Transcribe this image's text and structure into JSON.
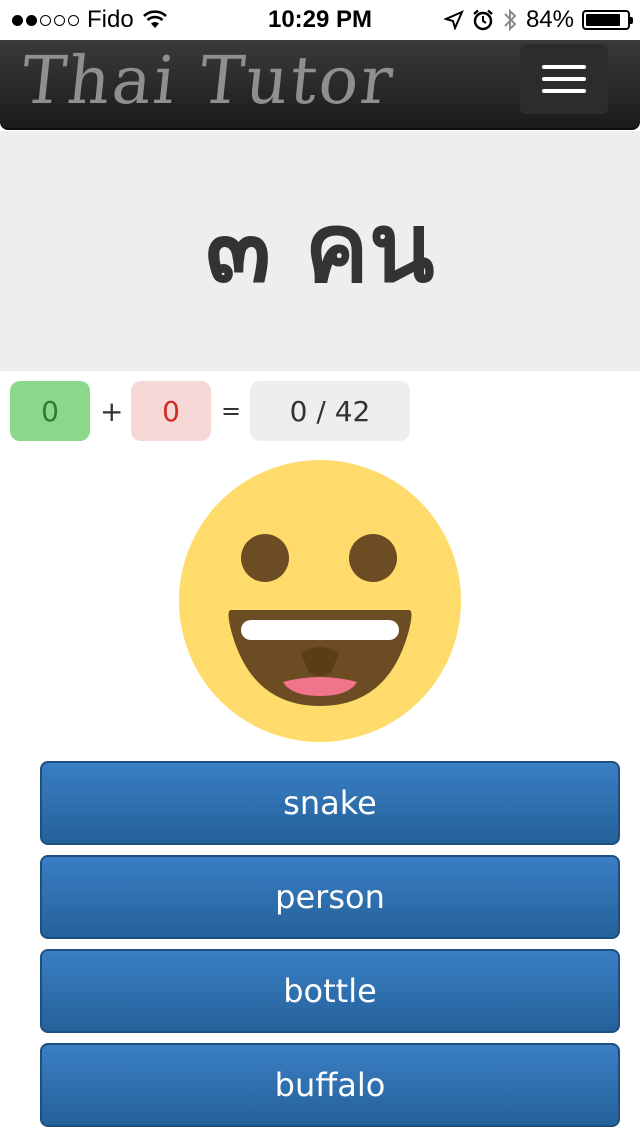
{
  "status_bar": {
    "carrier": "Fido",
    "signal_bars_filled": 2,
    "signal_bars_total": 5,
    "time": "10:29 PM",
    "battery": "84%",
    "battery_level": 0.84
  },
  "header": {
    "brand": "Thai Tutor",
    "menu_icon": "hamburger-menu-icon"
  },
  "question": {
    "thai_text": "๓ คน"
  },
  "score": {
    "correct": "0",
    "plus": "+",
    "wrong": "0",
    "equals": "=",
    "progress": "0 / 42"
  },
  "feedback": {
    "emoji_icon": "grinning-face-icon"
  },
  "answers": [
    {
      "label": "snake"
    },
    {
      "label": "person"
    },
    {
      "label": "bottle"
    },
    {
      "label": "buffalo"
    }
  ],
  "colors": {
    "correct_bg": "#8cd88a",
    "wrong_bg": "#f6d9d6",
    "button_blue": "#2e6fae",
    "emoji_yellow": "#fedb6a"
  }
}
